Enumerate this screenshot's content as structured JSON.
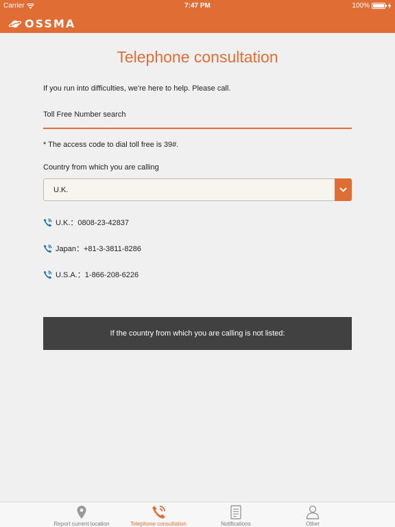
{
  "status_bar": {
    "carrier": "Carrier",
    "time": "7:47 PM",
    "battery": "100%",
    "battery_level": 1.0
  },
  "header": {
    "logo_text": "OSSMA"
  },
  "page": {
    "title": "Telephone consultation",
    "intro": "If you run into difficulties, we're here to help. Please call.",
    "section_title": "Toll Free Number search",
    "note": "* The access code to dial toll free is 39#.",
    "country_label": "Country from which you are calling",
    "selected_country": "U.K.",
    "phone_numbers": [
      {
        "text": "U.K.：0808-23-42837"
      },
      {
        "text": "Japan：+81-3-3811-8286"
      },
      {
        "text": "U.S.A.：1-866-208-6226"
      }
    ],
    "not_listed_label": "If the country from which you are calling is not listed:"
  },
  "tabbar": {
    "tabs": [
      {
        "label": "Report current location",
        "icon": "location-pin-icon",
        "active": false
      },
      {
        "label": "Telephone consultation",
        "icon": "phone-icon",
        "active": true
      },
      {
        "label": "Notifications",
        "icon": "document-icon",
        "active": false
      },
      {
        "label": "Other",
        "icon": "person-icon",
        "active": false
      }
    ]
  },
  "colors": {
    "accent": "#e06d34",
    "phone_icon": "#1f6fb8",
    "dark_button": "#414141",
    "inactive_icon": "#9a9a9a"
  }
}
